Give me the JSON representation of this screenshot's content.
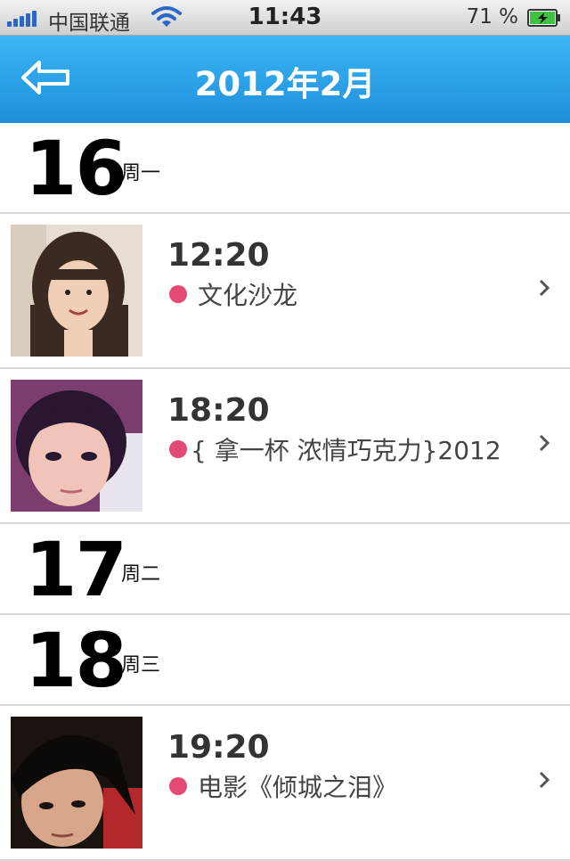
{
  "status_bar": {
    "carrier": "中国联通",
    "time": "11:43",
    "battery_percent": "71 %"
  },
  "nav": {
    "title": "2012年2月",
    "back_icon": "back-arrow-icon"
  },
  "accent_colors": {
    "nav_blue": "#2a9ce8",
    "event_dot": "#e44a72"
  },
  "days": [
    {
      "day": "16",
      "weekday": "周一",
      "events": [
        {
          "time": "12:20",
          "title": "文化沙龙"
        },
        {
          "time": "18:20",
          "title": "{ 拿一杯 浓情巧克力}2012"
        }
      ]
    },
    {
      "day": "17",
      "weekday": "周二",
      "events": []
    },
    {
      "day": "18",
      "weekday": "周三",
      "events": [
        {
          "time": "19:20",
          "title": "电影《倾城之泪》"
        }
      ]
    }
  ]
}
